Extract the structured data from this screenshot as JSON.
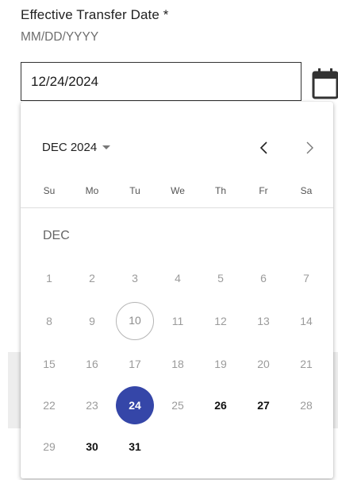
{
  "field": {
    "label": "Effective Transfer Date *",
    "hint": "MM/DD/YYYY",
    "value": "12/24/2024"
  },
  "icons": {
    "calendar": "calendar-icon",
    "prev": "chevron-left-icon",
    "next": "chevron-right-icon",
    "caret": "caret-down-icon"
  },
  "datepicker": {
    "month_select_label": "DEC 2024",
    "weekdays": [
      "Su",
      "Mo",
      "Tu",
      "We",
      "Th",
      "Fr",
      "Sa"
    ],
    "month_label": "DEC",
    "selected_day": "24",
    "today_day": "10",
    "weeks": [
      [
        {
          "day": "1",
          "state": "disabled"
        },
        {
          "day": "2",
          "state": "disabled"
        },
        {
          "day": "3",
          "state": "disabled"
        },
        {
          "day": "4",
          "state": "disabled"
        },
        {
          "day": "5",
          "state": "disabled"
        },
        {
          "day": "6",
          "state": "disabled"
        },
        {
          "day": "7",
          "state": "disabled"
        }
      ],
      [
        {
          "day": "8",
          "state": "disabled"
        },
        {
          "day": "9",
          "state": "disabled"
        },
        {
          "day": "10",
          "state": "today"
        },
        {
          "day": "11",
          "state": "disabled"
        },
        {
          "day": "12",
          "state": "disabled"
        },
        {
          "day": "13",
          "state": "disabled"
        },
        {
          "day": "14",
          "state": "disabled"
        }
      ],
      [
        {
          "day": "15",
          "state": "disabled"
        },
        {
          "day": "16",
          "state": "disabled"
        },
        {
          "day": "17",
          "state": "disabled"
        },
        {
          "day": "18",
          "state": "disabled"
        },
        {
          "day": "19",
          "state": "disabled"
        },
        {
          "day": "20",
          "state": "disabled"
        },
        {
          "day": "21",
          "state": "disabled"
        }
      ],
      [
        {
          "day": "22",
          "state": "disabled"
        },
        {
          "day": "23",
          "state": "disabled"
        },
        {
          "day": "24",
          "state": "selected"
        },
        {
          "day": "25",
          "state": "disabled"
        },
        {
          "day": "26",
          "state": "enabled"
        },
        {
          "day": "27",
          "state": "enabled"
        },
        {
          "day": "28",
          "state": "disabled"
        }
      ],
      [
        {
          "day": "29",
          "state": "disabled"
        },
        {
          "day": "30",
          "state": "enabled"
        },
        {
          "day": "31",
          "state": "enabled"
        }
      ]
    ]
  },
  "colors": {
    "selected_bg": "#3546a8",
    "disabled_text": "#9b9b9b",
    "enabled_text": "#111111"
  }
}
